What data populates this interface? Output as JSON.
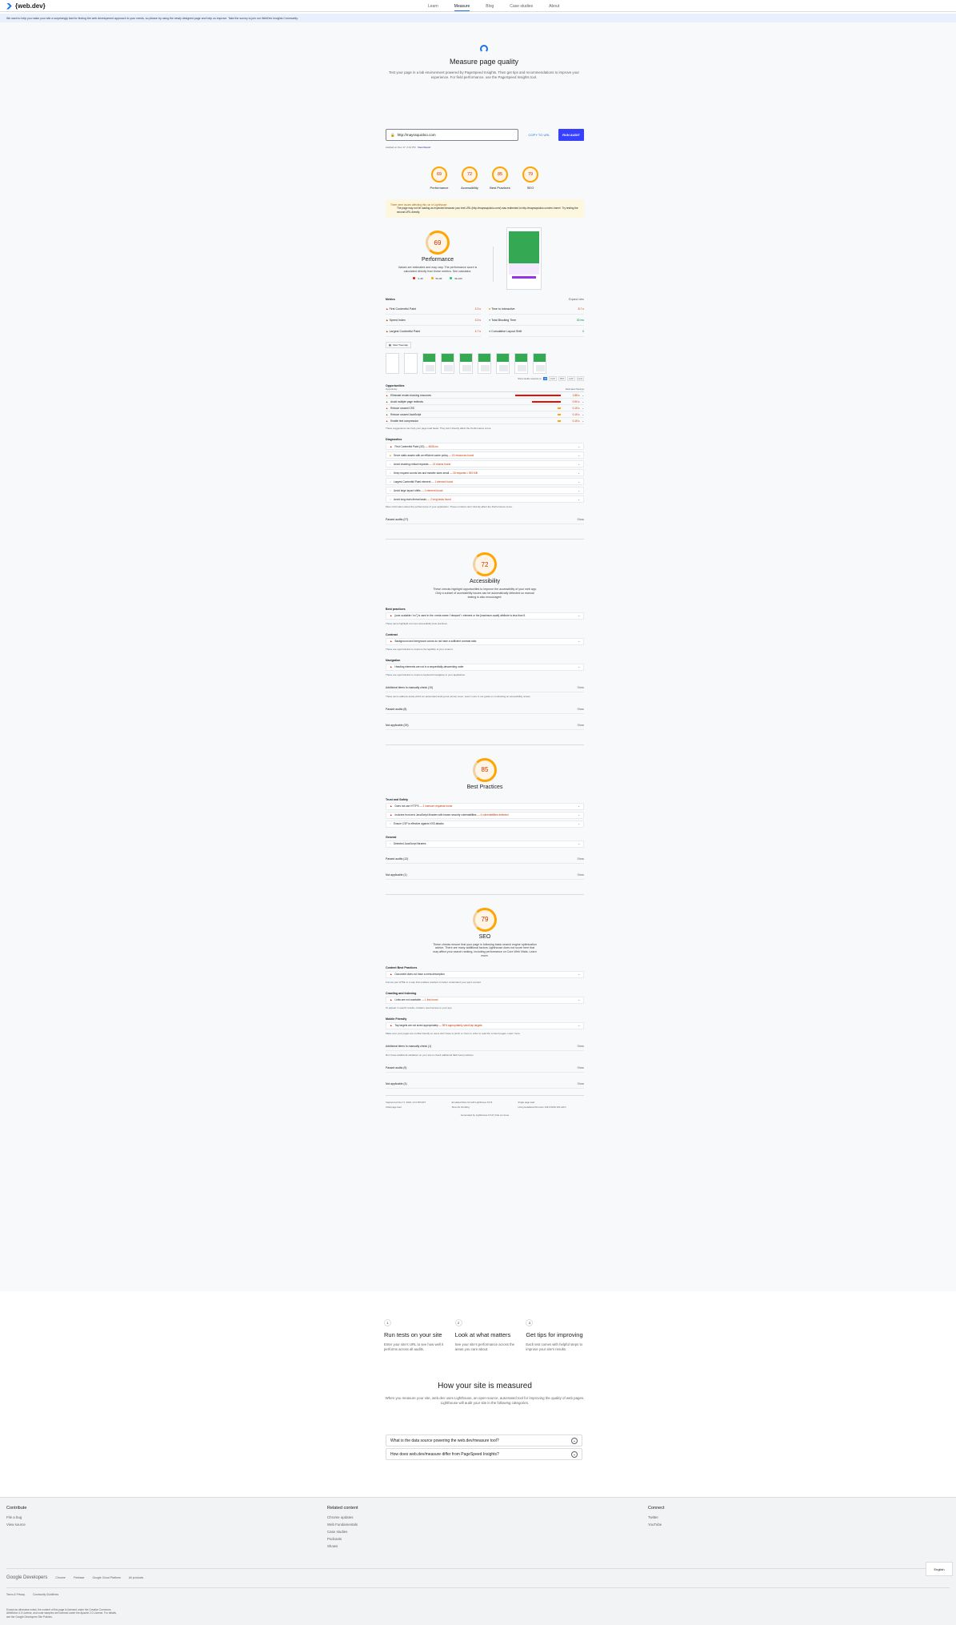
{
  "brand": {
    "name": "{web.dev}"
  },
  "nav": {
    "items": [
      "Learn",
      "Measure",
      "Blog",
      "Case studies",
      "About"
    ],
    "active": "Measure"
  },
  "banner": {
    "text": "We want to help you make your site a surprisingly fast for finding the web development approach to your needs, so please try using the newly designed page and help us improve. Take the survey to join our WebDev Insights Community."
  },
  "hero": {
    "title": "Measure page quality",
    "description": "Test your page in a lab environment powered by PageSpeed Insights. Then get tips and recommendations to improve your experience. For field performance, use the PageSpeed Insights tool."
  },
  "urlbar": {
    "value": "http://mayssquickio.com",
    "copy_label": "COPY TO URL",
    "run_label": "RUN AUDIT"
  },
  "audited": {
    "text": "Audited on Nov 17, 2:12 PM",
    "link": "View Report"
  },
  "scores": [
    {
      "label": "Performance",
      "value": "69"
    },
    {
      "label": "Accessibility",
      "value": "72"
    },
    {
      "label": "Best Practices",
      "value": "85"
    },
    {
      "label": "SEO",
      "value": "79"
    }
  ],
  "warning": {
    "title": "There were issues affecting this run of Lighthouse:",
    "text": "The page may not be loading as expected because your test URL (http://mayssquickio.com/) was redirected to http://mayssquickio.com/en-home/. Try testing the second URL directly."
  },
  "performance": {
    "score": "69",
    "title": "Performance",
    "description": "Values are estimated and may vary. The performance score is calculated directly from these metrics. See calculator.",
    "legend": [
      "0–49",
      "50–89",
      "90–100"
    ],
    "metrics_label": "Metrics",
    "expand_label": "Expand view",
    "metrics": [
      {
        "name": "First Contentful Paint",
        "value": "2.3 s",
        "status": "red"
      },
      {
        "name": "Time to Interactive",
        "value": "8.7 s",
        "status": "orange"
      },
      {
        "name": "Speed Index",
        "value": "3.3 s",
        "status": "red"
      },
      {
        "name": "Total Blocking Time",
        "value": "30 ms",
        "status": "green"
      },
      {
        "name": "Largest Contentful Paint",
        "value": "4.7 s",
        "status": "red"
      },
      {
        "name": "Cumulative Layout Shift",
        "value": "0",
        "status": "green"
      }
    ],
    "treemap_label": "View Treemap",
    "filter_label": "Show audits relevant to:",
    "filter_chips": [
      "All",
      "FCP",
      "TBT",
      "LCP",
      "CLS"
    ],
    "opportunities_title": "Opportunities",
    "opp_col1": "Opportunity",
    "opp_col2": "Estimated Savings",
    "opportunities": [
      {
        "name": "Eliminate render-blocking resources",
        "value": "1.88 s",
        "bar": 0.95
      },
      {
        "name": "Avoid multiple page redirects",
        "value": "0.90 s",
        "bar": 0.6
      },
      {
        "name": "Reduce unused CSS",
        "value": "0.15 s",
        "bar": 0.08
      },
      {
        "name": "Reduce unused JavaScript",
        "value": "0.15 s",
        "bar": 0.08
      },
      {
        "name": "Enable text compression",
        "value": "0.15 s",
        "bar": 0.08
      }
    ],
    "opp_note": "These suggestions can help your page load faster. They don't directly affect the Performance score.",
    "diagnostics_title": "Diagnostics",
    "diagnostics": [
      {
        "name": "First Contentful Paint (3G)",
        "detail": "— 4838 ms",
        "kind": "tri"
      },
      {
        "name": "Serve static assets with an efficient cache policy",
        "detail": "— 15 resources found",
        "kind": "sq"
      },
      {
        "name": "Avoid chaining critical requests",
        "detail": "— 13 chains found",
        "kind": "ci"
      },
      {
        "name": "Keep request counts low and transfer sizes small",
        "detail": "— 26 requests • 393 KiB",
        "kind": "ci"
      },
      {
        "name": "Largest Contentful Paint element",
        "detail": "— 1 element found",
        "kind": "ci"
      },
      {
        "name": "Avoid large layout shifts",
        "detail": "— 1 element found",
        "kind": "ci"
      },
      {
        "name": "Avoid long main-thread tasks",
        "detail": "— 2 long tasks found",
        "kind": "ci"
      }
    ],
    "diag_note": "More information about the performance of your application. These numbers don't directly affect the Performance score.",
    "passed_label": "Passed audits (27)",
    "show_label": "Show"
  },
  "accessibility": {
    "score": "72",
    "title": "Accessibility",
    "description": "These checks highlight opportunities to improve the accessibility of your web app. Only a subset of accessibility issues can be automatically detected so manual testing is also encouraged.",
    "groups": [
      {
        "title": "Best practices",
        "rows": [
          "[user-scalable=\"no\"] is used in the <meta name=\"viewport\"> element or the [maximum-scale] attribute is less than 5."
        ],
        "note": "These items highlight common accessibility best practices."
      },
      {
        "title": "Contrast",
        "rows": [
          "Background and foreground colors do not have a sufficient contrast ratio."
        ],
        "note": "These are opportunities to improve the legibility of your content."
      },
      {
        "title": "Navigation",
        "rows": [
          "Heading elements are not in a sequentially-descending order"
        ],
        "note": "These are opportunities to improve keyboard navigation in your application."
      }
    ],
    "manual_label": "Additional items to manually check (10)",
    "manual_note": "These items address areas which an automated testing tool cannot cover. Learn more in our guide on conducting an accessibility review.",
    "passed_label": "Passed audits (8)",
    "na_label": "Not applicable (25)",
    "show_label": "Show"
  },
  "best_practices": {
    "score": "85",
    "title": "Best Practices",
    "groups": [
      {
        "title": "Trust and Safety",
        "rows": [
          {
            "name": "Does not use HTTPS",
            "detail": "— 2 insecure requests found",
            "kind": "tri"
          },
          {
            "name": "Includes front-end JavaScript libraries with known security vulnerabilities",
            "detail": "— 4 vulnerabilities detected",
            "kind": "tri"
          },
          {
            "name": "Ensure CSP is effective against XSS attacks",
            "detail": "",
            "kind": "ci"
          }
        ]
      },
      {
        "title": "General",
        "rows": [
          {
            "name": "Detected JavaScript libraries",
            "detail": "",
            "kind": "ci"
          }
        ]
      }
    ],
    "passed_label": "Passed audits (12)",
    "na_label": "Not applicable (1)",
    "show_label": "Show"
  },
  "seo": {
    "score": "79",
    "title": "SEO",
    "description": "These checks ensure that your page is following basic search engine optimization advice. There are many additional factors Lighthouse does not score here that may affect your search ranking, including performance on Core Web Vitals. Learn more.",
    "groups": [
      {
        "title": "Content Best Practices",
        "row": "Document does not have a meta description",
        "detail": "",
        "note": "Format your HTML in a way that enables crawlers to better understand your app's content."
      },
      {
        "title": "Crawling and Indexing",
        "row": "Links are not crawlable",
        "detail": "— 1 link found",
        "note": "To appear in search results, crawlers need access to your app."
      },
      {
        "title": "Mobile Friendly",
        "row": "Tap targets are not sized appropriately",
        "detail": "— 98% appropriately sized tap targets",
        "note": "Make sure your pages are mobile friendly so users don't have to pinch or zoom in order to read the content pages. Learn more."
      }
    ],
    "manual_label": "Additional items to manually check (1)",
    "manual_note": "Run these additional validators on your site to check additional SEO best practices.",
    "passed_label": "Passed audits (9)",
    "na_label": "Not applicable (3)",
    "show_label": "Show"
  },
  "env": [
    "Captured at Nov 17, 2022, 2:12 PM EST",
    "Emulated Moto G4 with Lighthouse 9.6.8",
    "Single page load",
    "Initial page load",
    "Slow 4G throttling",
    "Using HeadlessChromium 106.0.5249.103 with lr"
  ],
  "generated": "Generated by Lighthouse 9.6.8 | File an issue",
  "steps": [
    {
      "num": "1",
      "title": "Run tests on your site",
      "desc": "Enter your site's URL to see how well it performs across all audits."
    },
    {
      "num": "2",
      "title": "Look at what matters",
      "desc": "See your site's performance across the areas you care about."
    },
    {
      "num": "3",
      "title": "Get tips for improving",
      "desc": "Each test comes with helpful steps to improve your site's results."
    }
  ],
  "measured": {
    "title": "How your site is measured",
    "text": "When you measure your site, web.dev uses Lighthouse, an open-source, automated tool for improving the quality of web pages. Lighthouse will audit your site in the following categories."
  },
  "faq": [
    "What is the data source powering the web.dev/measure tool?",
    "How does web.dev/measure differ from PageSpeed Insights?"
  ],
  "footer": {
    "cols": [
      {
        "title": "Contribute",
        "items": [
          "File a bug",
          "View source"
        ]
      },
      {
        "title": "Related content",
        "items": [
          "Chrome updates",
          "Web Fundamentals",
          "Case studies",
          "Podcasts",
          "Shows"
        ]
      },
      {
        "title": "Connect",
        "items": [
          "Twitter",
          "YouTube"
        ]
      }
    ],
    "google": "Google Developers",
    "links": [
      "Chrome",
      "Firebase",
      "Google Cloud Platform",
      "All products"
    ],
    "lang": "English",
    "legal": [
      "Terms & Privacy",
      "Community Guidelines"
    ],
    "note": "Except as otherwise noted, the content of this page is licensed under the Creative Commons Attribution 4.0 License, and code samples are licensed under the Apache 2.0 License. For details, see the Google Developers Site Policies."
  }
}
